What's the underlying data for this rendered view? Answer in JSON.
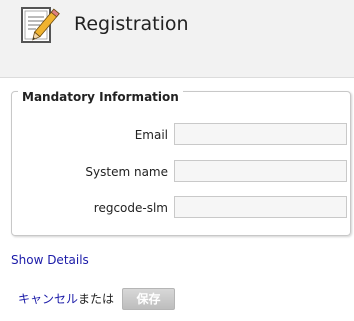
{
  "header": {
    "title": "Registration",
    "icon": "document-pencil-icon"
  },
  "form": {
    "section_title": "Mandatory Information",
    "fields": [
      {
        "label": "Email",
        "value": "",
        "placeholder": ""
      },
      {
        "label": "System name",
        "value": "",
        "placeholder": ""
      },
      {
        "label": "regcode-slm",
        "value": "",
        "placeholder": ""
      }
    ]
  },
  "links": {
    "show_details": "Show Details"
  },
  "actions": {
    "cancel_label": "キャンセル",
    "or_text": "または",
    "save_label": "保存"
  },
  "colors": {
    "link": "#1a1aa8",
    "header_background": "#f2f2f2",
    "input_background": "#f6f6f6",
    "save_button_background": "#c8c8c8"
  }
}
